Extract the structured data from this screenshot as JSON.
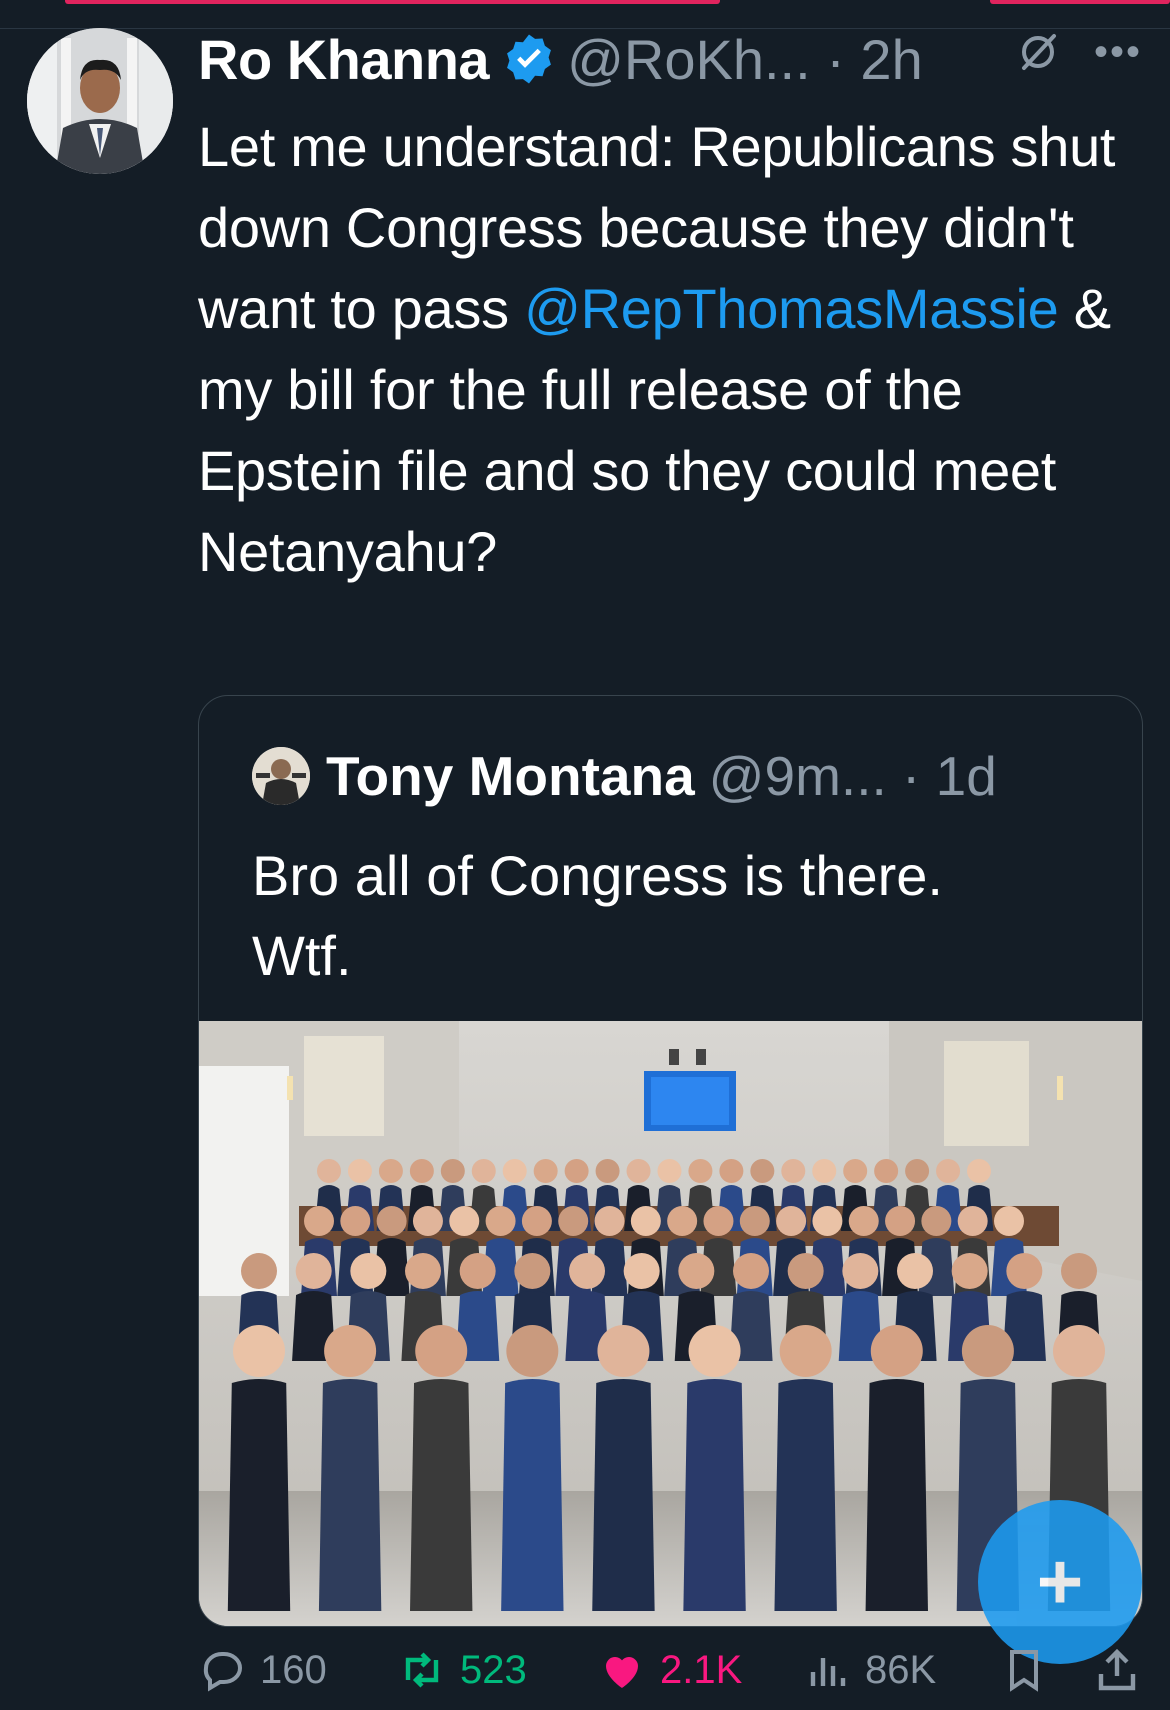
{
  "tweet": {
    "author_name": "Ro Khanna",
    "author_handle_time": "@RoKh... · 2h",
    "text_before_mention": "Let me understand: Republicans shut down Congress because they didn't want to pass ",
    "mention": "@RepThomasMassie",
    "text_after_mention": " & my bill for the full release of the Epstein file and so they could meet Netanyahu?"
  },
  "quote": {
    "author_name": "Tony Montana",
    "author_handle_time": "@9m... · 1d",
    "text_line1": "Bro all of Congress is there.",
    "text_line2": "Wtf."
  },
  "actions": {
    "replies": "160",
    "reposts": "523",
    "likes": "2.1K",
    "views": "86K"
  },
  "fab": {
    "label": "+"
  },
  "icons": {
    "verified": "verified-badge-icon",
    "grok": "grok-icon",
    "more": "more-icon",
    "reply": "reply-icon",
    "repost": "repost-icon",
    "like": "heart-icon",
    "views": "views-icon",
    "bookmark": "bookmark-icon",
    "share": "share-icon"
  },
  "colors": {
    "background": "#141d26",
    "accent": "#1d9bf0",
    "muted": "#8b98a5",
    "repost": "#00ba7c",
    "like": "#f91880"
  }
}
